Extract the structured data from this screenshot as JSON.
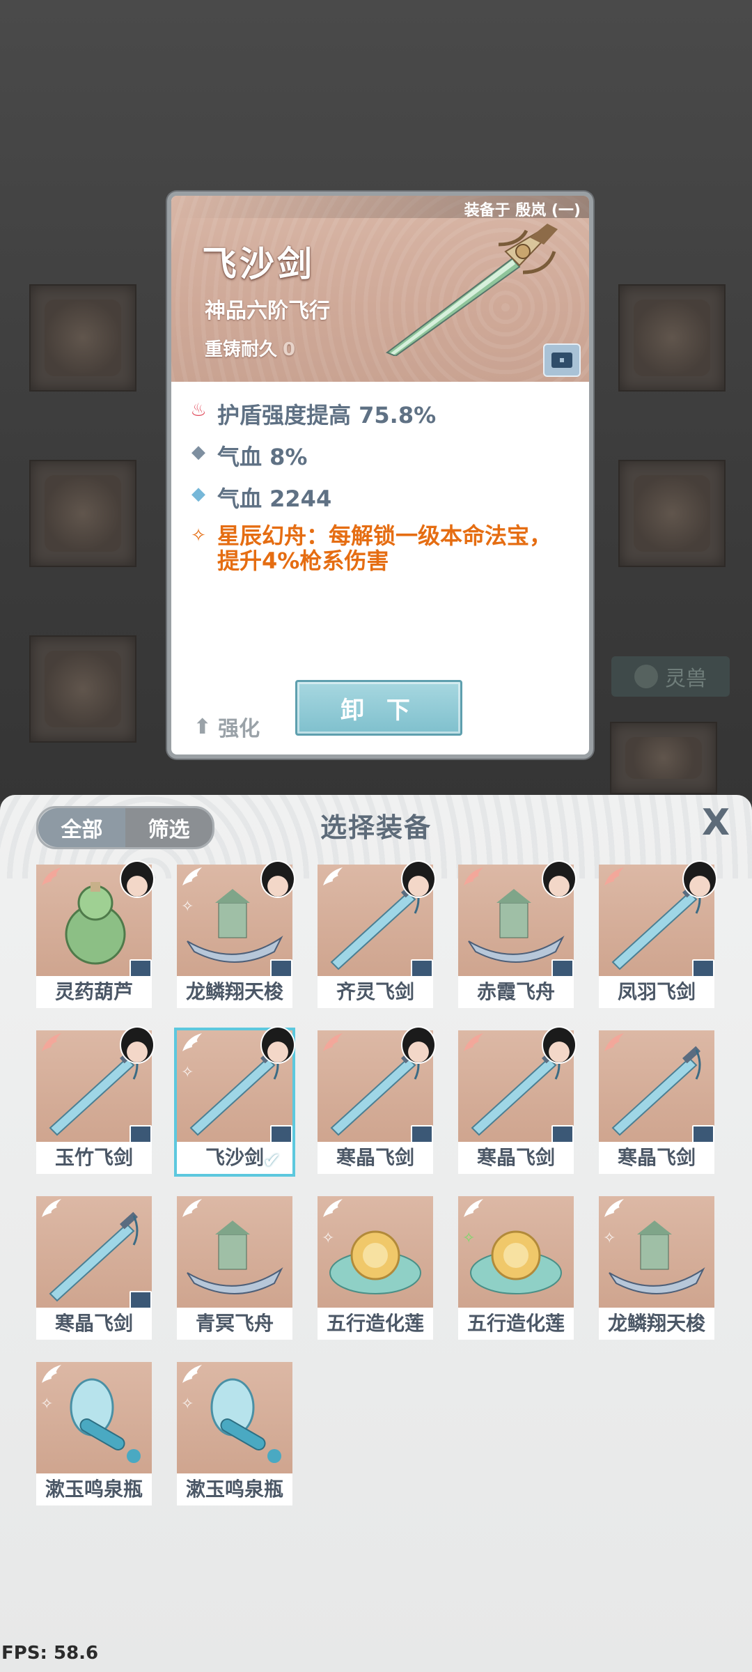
{
  "popup": {
    "equipped_text": "装备于 殷岚 (一)",
    "item_name": "飞沙剑",
    "item_grade": "神品六阶飞行",
    "durability_label": "重铸耐久",
    "durability_value": "0",
    "stats": [
      {
        "icon": "lotus-red-icon",
        "text": "护盾强度提高 75.8%"
      },
      {
        "icon": "diamond-gray-icon",
        "text": "气血 8%"
      },
      {
        "icon": "diamond-blue-icon",
        "text": "气血 2244"
      },
      {
        "icon": "star-rune-orange-icon",
        "text": "星辰幻舟：每解锁一级本命法宝，提升4%枪系伤害"
      }
    ],
    "enhance_label": "强化",
    "unequip_label": "卸 下"
  },
  "sheet": {
    "title": "选择装备",
    "filter_all": "全部",
    "filter_screen": "筛选",
    "close": "X"
  },
  "items": [
    {
      "name": "灵药葫芦",
      "owned_by_char": true,
      "chest": true,
      "rune": false
    },
    {
      "name": "龙鳞翔天梭",
      "owned_by_char": true,
      "chest": true,
      "rune": true
    },
    {
      "name": "齐灵飞剑",
      "owned_by_char": true,
      "chest": true,
      "rune": false
    },
    {
      "name": "赤霞飞舟",
      "owned_by_char": true,
      "chest": true,
      "rune": false
    },
    {
      "name": "凤羽飞剑",
      "owned_by_char": true,
      "chest": true,
      "rune": false
    },
    {
      "name": "玉竹飞剑",
      "owned_by_char": true,
      "chest": true,
      "rune": false
    },
    {
      "name": "飞沙剑",
      "owned_by_char": true,
      "chest": true,
      "rune": true,
      "selected": true
    },
    {
      "name": "寒晶飞剑",
      "owned_by_char": true,
      "chest": true,
      "rune": false
    },
    {
      "name": "寒晶飞剑",
      "owned_by_char": true,
      "chest": true,
      "rune": false
    },
    {
      "name": "寒晶飞剑",
      "owned_by_char": false,
      "chest": true,
      "rune": false
    },
    {
      "name": "寒晶飞剑",
      "owned_by_char": false,
      "chest": true,
      "rune": false
    },
    {
      "name": "青冥飞舟",
      "owned_by_char": false,
      "chest": false,
      "rune": false
    },
    {
      "name": "五行造化莲",
      "owned_by_char": false,
      "chest": false,
      "rune": true
    },
    {
      "name": "五行造化莲",
      "owned_by_char": false,
      "chest": false,
      "rune": true
    },
    {
      "name": "龙鳞翔天梭",
      "owned_by_char": false,
      "chest": false,
      "rune": true
    },
    {
      "name": "漱玉鸣泉瓶",
      "owned_by_char": false,
      "chest": false,
      "rune": true
    },
    {
      "name": "漱玉鸣泉瓶",
      "owned_by_char": false,
      "chest": false,
      "rune": true
    }
  ],
  "background": {
    "tab_label": "灵兽"
  },
  "fps": "FPS: 58.6"
}
